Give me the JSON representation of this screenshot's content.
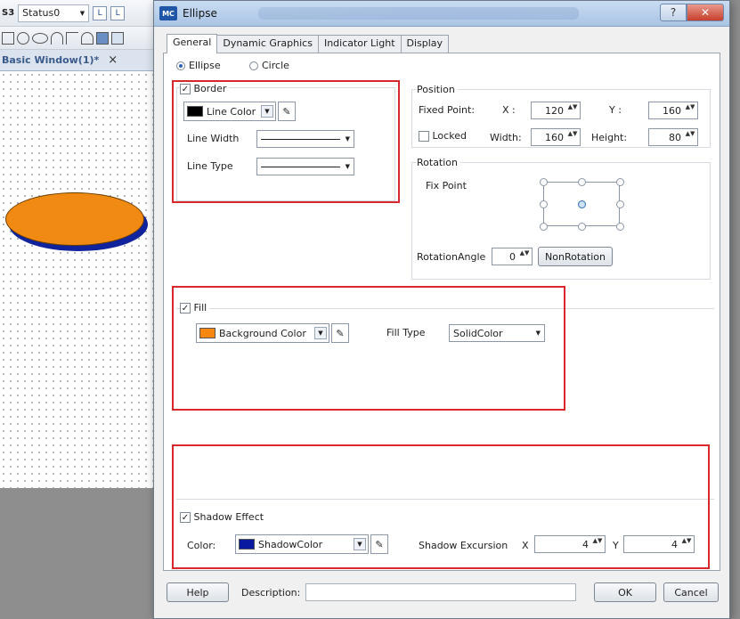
{
  "editor": {
    "status_label": "Status0",
    "doc_tab": "Basic Window(1)*",
    "doc_tab_close": "×",
    "status_prefix": "S3",
    "ellipse_fill": "#f08a12",
    "ellipse_shadow": "#10239c"
  },
  "dialog": {
    "logo": "MC",
    "title": "Ellipse",
    "help_btn": "?",
    "close_btn": "✕"
  },
  "tabs": [
    "General",
    "Dynamic Graphics",
    "Indicator Light",
    "Display"
  ],
  "shape": {
    "ellipse_label": "Ellipse",
    "circle_label": "Circle",
    "selected": "Ellipse"
  },
  "border": {
    "title": "Border",
    "checked": true,
    "line_color_label": "Line Color",
    "line_color_value": "#000000",
    "line_width_label": "Line Width",
    "line_type_label": "Line Type"
  },
  "position": {
    "title": "Position",
    "fixed_point_label": "Fixed Point:",
    "x_label": "X :",
    "x_value": "120",
    "y_label": "Y :",
    "y_value": "160",
    "locked_label": "Locked",
    "locked_checked": false,
    "width_label": "Width:",
    "width_value": "160",
    "height_label": "Height:",
    "height_value": "80"
  },
  "rotation": {
    "title": "Rotation",
    "fix_point_label": "Fix Point",
    "angle_label": "RotationAngle",
    "angle_value": "0",
    "nonrotation_label": "NonRotation"
  },
  "fill": {
    "title": "Fill",
    "checked": true,
    "bg_color_label": "Background Color",
    "bg_color_value": "#f7870e",
    "fill_type_label": "Fill Type",
    "fill_type_value": "SolidColor"
  },
  "shadow": {
    "title": "Shadow Effect",
    "checked": true,
    "color_label": "Color:",
    "color_name": "ShadowColor",
    "color_value": "#0a1aa0",
    "excursion_label": "Shadow Excursion",
    "x_label": "X",
    "x_value": "4",
    "y_label": "Y",
    "y_value": "4"
  },
  "footer": {
    "help_label": "Help",
    "description_label": "Description:",
    "description_value": "",
    "ok_label": "OK",
    "cancel_label": "Cancel"
  },
  "icons": {
    "checkmark": "✓",
    "dropdown": "▼",
    "spin": "▲▼",
    "picker": "✎"
  },
  "colors": {
    "highlight_box": "#d8272d"
  }
}
